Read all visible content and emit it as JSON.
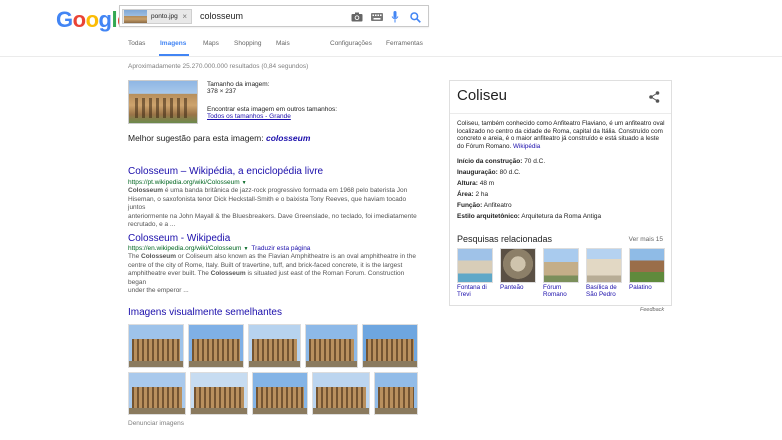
{
  "header": {
    "logo_letters": [
      {
        "ch": "G",
        "color": "#4285f4"
      },
      {
        "ch": "o",
        "color": "#ea4335"
      },
      {
        "ch": "o",
        "color": "#fbbc05"
      },
      {
        "ch": "g",
        "color": "#4285f4"
      },
      {
        "ch": "l",
        "color": "#34a853"
      },
      {
        "ch": "e",
        "color": "#ea4335"
      }
    ],
    "image_chip_label": "ponto.jpg",
    "image_chip_close": "×",
    "query": "colosseum",
    "icons": [
      "camera-icon",
      "keyboard-icon",
      "microphone-icon",
      "search-icon"
    ]
  },
  "tabs": {
    "items": [
      {
        "label": "Todas",
        "active": false
      },
      {
        "label": "Imagens",
        "active": true
      },
      {
        "label": "Maps",
        "active": false
      },
      {
        "label": "Shopping",
        "active": false
      },
      {
        "label": "Mais",
        "active": false
      },
      {
        "label": "Configurações",
        "active": false
      },
      {
        "label": "Ferramentas",
        "active": false
      }
    ],
    "accent": "#4285f4"
  },
  "stats": "Aproximadamente 25.270.000.000 resultados (0,84 segundos)",
  "query_image": {
    "size_label": "Tamanho da imagem:",
    "size_value": "378 × 237",
    "find_label": "Encontrar esta imagem em outros tamanhos:",
    "find_link": "Todos os tamanhos - Grande"
  },
  "best_guess": {
    "label": "Melhor sugestão para esta imagem:",
    "value": "colosseum"
  },
  "results": [
    {
      "title": "Colosseum – Wikipédia, a enciclopédia livre",
      "url": "https://pt.wikipedia.org/wiki/Colosseum",
      "translate": "",
      "snippet": [
        "Colosseum é uma banda britânica de jazz-rock progressivo formada em 1968 pelo baterista Jon",
        "Hiseman, o saxofonista tenor Dick Heckstall-Smith e o baixista Tony Reeves, que haviam tocado juntos",
        "anteriormente na John Mayall & the Bluesbreakers. Dave Greenslade, no teclado, foi imediatamente",
        "recrutado, e a ..."
      ]
    },
    {
      "title": "Colosseum - Wikipedia",
      "url": "https://en.wikipedia.org/wiki/Colosseum",
      "translate": "Traduzir esta página",
      "snippet": [
        "The Colosseum or Coliseum also known as the Flavian Amphitheatre is an oval amphitheatre in the",
        "centre of the city of Rome, Italy. Built of travertine, tuff, and brick-faced concrete, it is the largest",
        "amphitheatre ever built. The Colosseum is situated just east of the Roman Forum. Construction began",
        "under the emperor ..."
      ]
    }
  ],
  "similar": {
    "title": "Imagens visualmente semelhantes",
    "report": "Denunciar imagens"
  },
  "knowledge_panel": {
    "title": "Coliseu",
    "description": "Coliseu, também conhecido como Anfiteatro Flaviano, é um anfiteatro oval localizado no centro da cidade de Roma, capital da Itália. Construído com concreto e areia, é o maior anfiteatro já construído e está situado a leste do Fórum Romano.",
    "source": "Wikipédia",
    "facts": [
      {
        "label": "Início da construção:",
        "value": "70 d.C."
      },
      {
        "label": "Inauguração:",
        "value": "80 d.C."
      },
      {
        "label": "Altura:",
        "value": "48 m"
      },
      {
        "label": "Área:",
        "value": "2 ha"
      },
      {
        "label": "Função:",
        "value": "Anfiteatro"
      },
      {
        "label": "Estilo arquitetônico:",
        "value": "Arquitetura da Roma Antiga"
      }
    ],
    "related_title": "Pesquisas relacionadas",
    "related_more": "Ver mais 15",
    "related": [
      {
        "label": "Fontana di Trevi"
      },
      {
        "label": "Panteão"
      },
      {
        "label": "Fórum Romano"
      },
      {
        "label": "Basílica de São Pedro"
      },
      {
        "label": "Palatino"
      }
    ],
    "feedback": "Feedback"
  }
}
